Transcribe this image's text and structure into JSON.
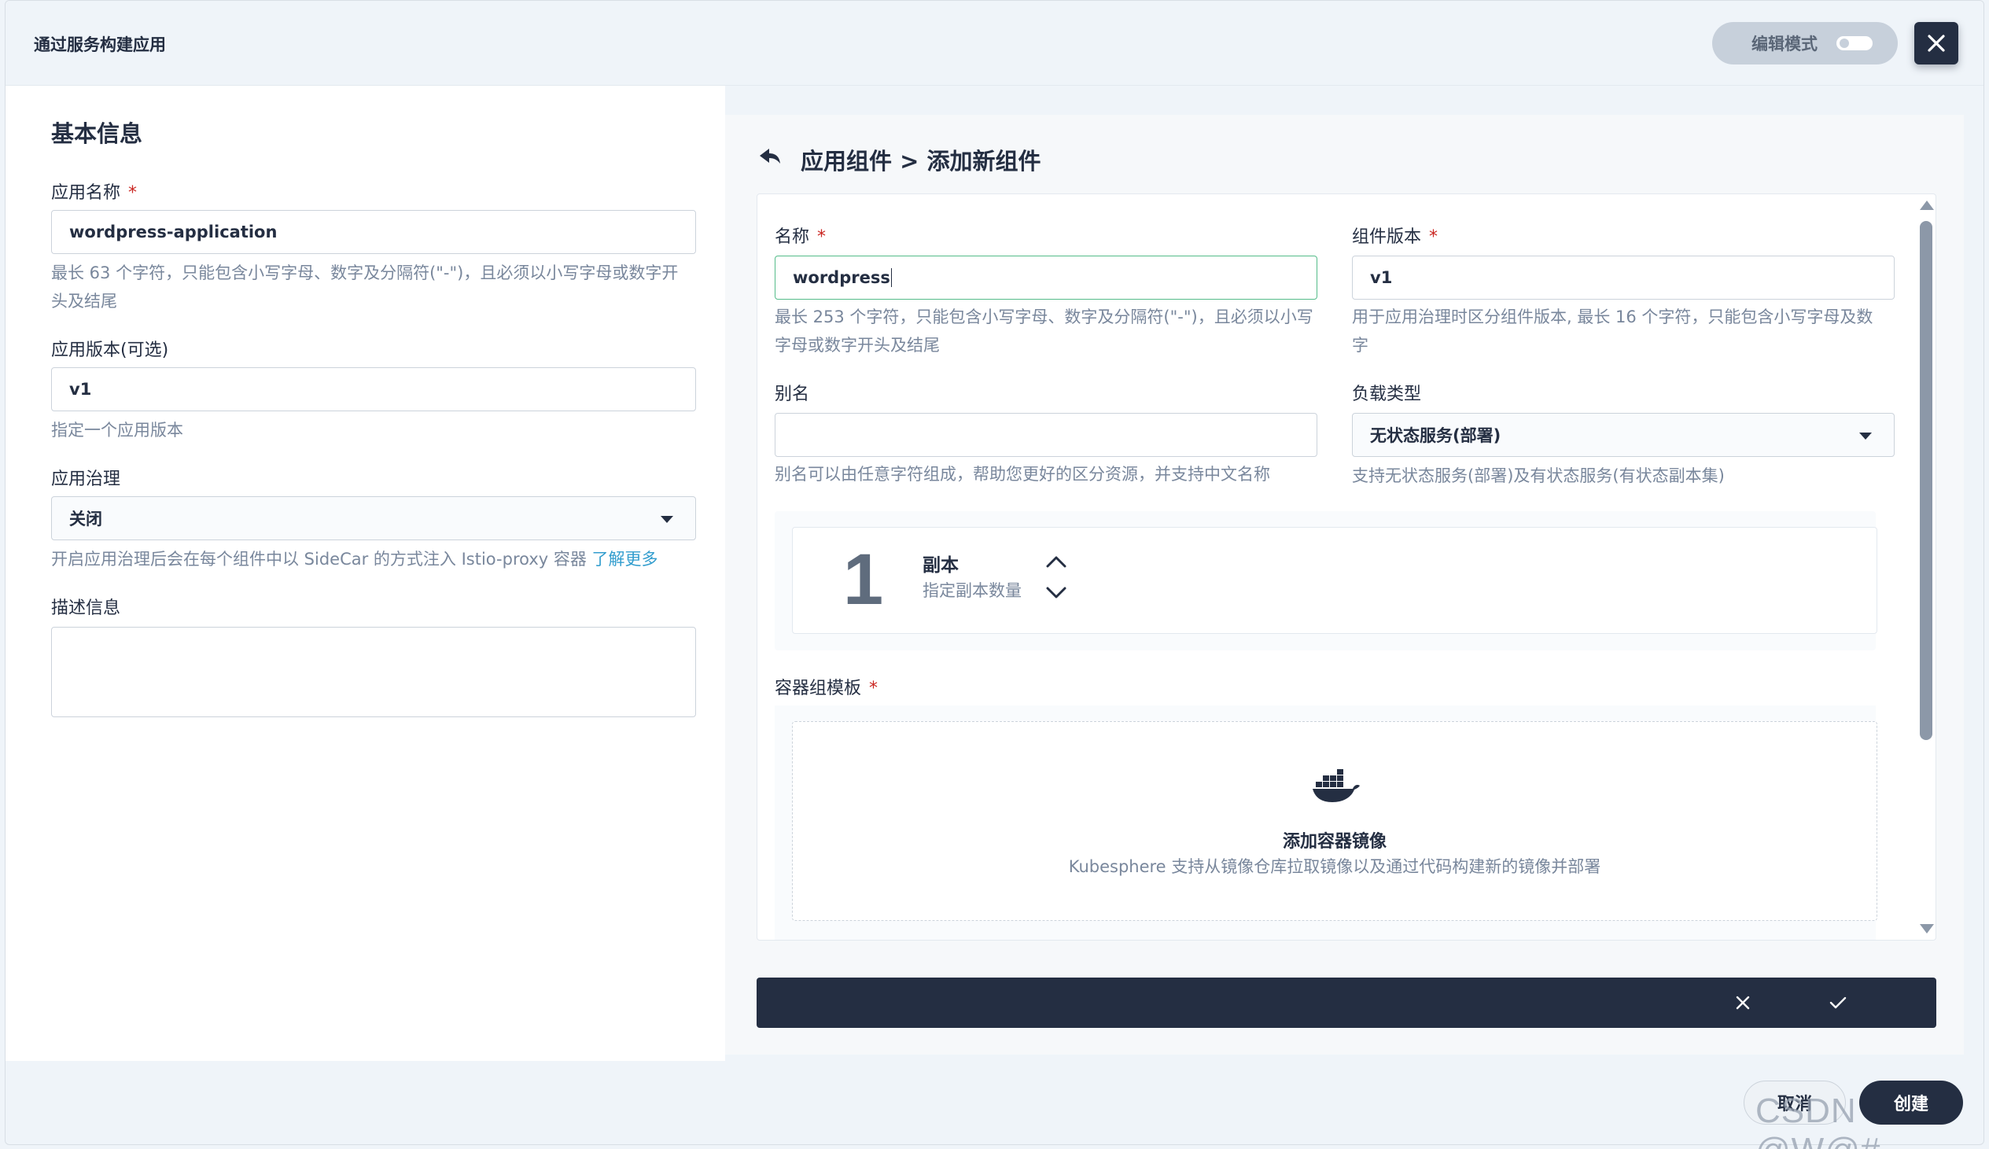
{
  "header": {
    "title": "通过服务构建应用",
    "edit_mode_label": "编辑模式"
  },
  "basic_info": {
    "section_title": "基本信息",
    "app_name": {
      "label": "应用名称",
      "required_mark": "*",
      "value": "wordpress-application",
      "hint_line1": "最长 63 个字符，只能包含小写字母、数字及分隔符(\"-\")，且必须以小写字母或数字开",
      "hint_line2": "头及结尾"
    },
    "app_version": {
      "label": "应用版本(可选)",
      "value": "v1",
      "hint": "指定一个应用版本"
    },
    "governance": {
      "label": "应用治理",
      "value": "关闭",
      "hint": "开启应用治理后会在每个组件中以 SideCar 的方式注入 Istio-proxy 容器 ",
      "link": "了解更多"
    },
    "description": {
      "label": "描述信息",
      "value": ""
    }
  },
  "component": {
    "breadcrumb": "应用组件 > 添加新组件",
    "name": {
      "label": "名称",
      "required_mark": "*",
      "value": "wordpress",
      "hint_line1": "最长 253 个字符，只能包含小写字母、数字及分隔符(\"-\")，且必须以小写",
      "hint_line2": "字母或数字开头及结尾"
    },
    "version": {
      "label": "组件版本",
      "required_mark": "*",
      "value": "v1",
      "hint_line1": "用于应用治理时区分组件版本, 最长 16 个字符，只能包含小写字母及数",
      "hint_line2": "字"
    },
    "alias": {
      "label": "别名",
      "value": "",
      "hint": "别名可以由任意字符组成，帮助您更好的区分资源，并支持中文名称"
    },
    "workload_type": {
      "label": "负载类型",
      "value": "无状态服务(部署)",
      "hint": "支持无状态服务(部署)及有状态服务(有状态副本集)"
    },
    "replicas": {
      "count": "1",
      "title": "副本",
      "subtitle": "指定副本数量"
    },
    "container_template": {
      "label": "容器组模板",
      "required_mark": "*",
      "title": "添加容器镜像",
      "description": "Kubesphere 支持从镜像仓库拉取镜像以及通过代码构建新的镜像并部署"
    }
  },
  "footer": {
    "cancel_label": "取消",
    "create_label": "创建"
  },
  "watermark": "CSDN @W@#",
  "colors": {
    "dark": "#242e42",
    "focus_border": "#55bc8a",
    "required": "#ca2621",
    "link": "#329dce",
    "muted_text": "#79879c"
  }
}
